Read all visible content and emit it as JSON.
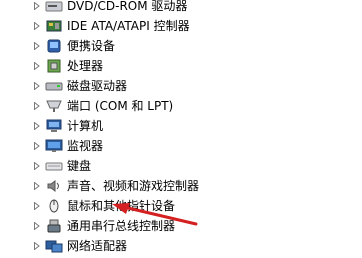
{
  "tree": {
    "items": [
      {
        "label": "DVD/CD-ROM 驱动器",
        "icon": "dvd-drive-icon"
      },
      {
        "label": "IDE ATA/ATAPI 控制器",
        "icon": "ide-controller-icon"
      },
      {
        "label": "便携设备",
        "icon": "portable-device-icon"
      },
      {
        "label": "处理器",
        "icon": "processor-icon"
      },
      {
        "label": "磁盘驱动器",
        "icon": "disk-drive-icon"
      },
      {
        "label": "端口 (COM 和 LPT)",
        "icon": "port-icon"
      },
      {
        "label": "计算机",
        "icon": "computer-icon"
      },
      {
        "label": "监视器",
        "icon": "monitor-icon"
      },
      {
        "label": "键盘",
        "icon": "keyboard-icon"
      },
      {
        "label": "声音、视频和游戏控制器",
        "icon": "sound-icon"
      },
      {
        "label": "鼠标和其他指针设备",
        "icon": "mouse-icon"
      },
      {
        "label": "通用串行总线控制器",
        "icon": "usb-icon"
      },
      {
        "label": "网络适配器",
        "icon": "network-adapter-icon"
      }
    ]
  },
  "annotation": {
    "color": "#d42020",
    "target": "鼠标和其他指针设备"
  }
}
